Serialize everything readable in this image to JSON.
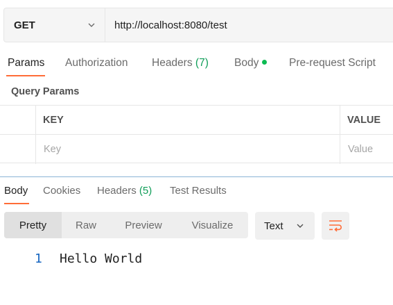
{
  "request": {
    "method": "GET",
    "url": "http://localhost:8080/test"
  },
  "request_tabs": [
    {
      "label": "Params",
      "active": true
    },
    {
      "label": "Authorization"
    },
    {
      "label": "Headers",
      "count": "(7)"
    },
    {
      "label": "Body",
      "indicator": "green-dot"
    },
    {
      "label": "Pre-request Script"
    }
  ],
  "query_params": {
    "title": "Query Params",
    "columns": [
      "KEY",
      "VALUE"
    ],
    "key_placeholder": "Key",
    "value_placeholder": "Value"
  },
  "response_tabs": [
    {
      "label": "Body",
      "active": true
    },
    {
      "label": "Cookies"
    },
    {
      "label": "Headers",
      "count": "(5)"
    },
    {
      "label": "Test Results"
    }
  ],
  "view_modes": [
    {
      "label": "Pretty",
      "active": true
    },
    {
      "label": "Raw"
    },
    {
      "label": "Preview"
    },
    {
      "label": "Visualize"
    }
  ],
  "format": {
    "selected": "Text",
    "icon": "chevron-down-icon"
  },
  "wrap_icon": "wrap-lines-icon",
  "response_body": [
    {
      "line": "1",
      "text": "Hello World"
    }
  ],
  "colors": {
    "accent": "#ff6c37",
    "count_green": "#0f9d58",
    "indicator_green": "#0cbb52",
    "line_number": "#1565c0"
  }
}
